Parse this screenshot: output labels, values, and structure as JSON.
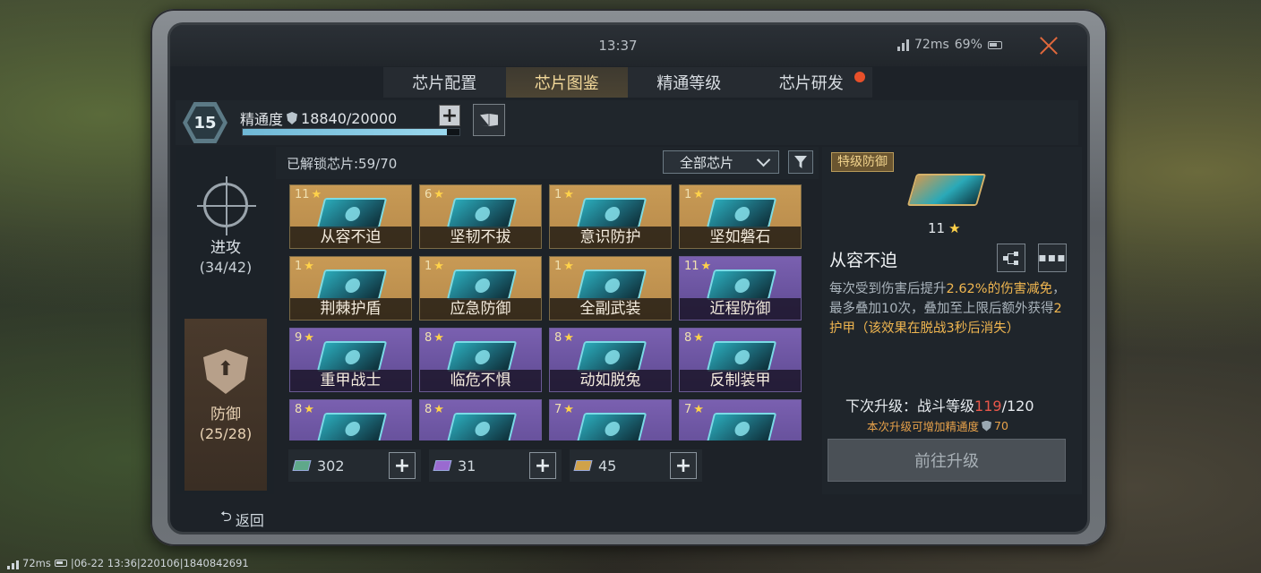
{
  "top": {
    "time": "13:37",
    "ping": "72ms",
    "battery": "69%"
  },
  "tabs": [
    {
      "label": "芯片配置",
      "active": false
    },
    {
      "label": "芯片图鉴",
      "active": true
    },
    {
      "label": "精通等级",
      "active": false
    },
    {
      "label": "芯片研发",
      "active": false,
      "badge": true
    }
  ],
  "mastery": {
    "level": "15",
    "label": "精通度",
    "value": "18840/20000",
    "progress_fraction": 0.942
  },
  "categories": [
    {
      "name": "进攻",
      "count": "(34/42)",
      "active": false
    },
    {
      "name": "防御",
      "count": "(25/28)",
      "active": true
    }
  ],
  "grid": {
    "unlocked_text": "已解锁芯片:59/70",
    "filter_selected": "全部芯片"
  },
  "chips": [
    {
      "stars": "11",
      "name": "从容不迫",
      "rarity": "gold"
    },
    {
      "stars": "6",
      "name": "坚韧不拔",
      "rarity": "gold"
    },
    {
      "stars": "1",
      "name": "意识防护",
      "rarity": "gold"
    },
    {
      "stars": "1",
      "name": "坚如磐石",
      "rarity": "gold"
    },
    {
      "stars": "1",
      "name": "荆棘护盾",
      "rarity": "gold"
    },
    {
      "stars": "1",
      "name": "应急防御",
      "rarity": "gold"
    },
    {
      "stars": "1",
      "name": "全副武装",
      "rarity": "gold"
    },
    {
      "stars": "11",
      "name": "近程防御",
      "rarity": "purple"
    },
    {
      "stars": "9",
      "name": "重甲战士",
      "rarity": "purple"
    },
    {
      "stars": "8",
      "name": "临危不惧",
      "rarity": "purple"
    },
    {
      "stars": "8",
      "name": "动如脱兔",
      "rarity": "purple"
    },
    {
      "stars": "8",
      "name": "反制装甲",
      "rarity": "purple"
    },
    {
      "stars": "8",
      "name": "",
      "rarity": "purple"
    },
    {
      "stars": "8",
      "name": "",
      "rarity": "purple"
    },
    {
      "stars": "7",
      "name": "",
      "rarity": "purple"
    },
    {
      "stars": "7",
      "name": "",
      "rarity": "purple"
    }
  ],
  "resources": [
    {
      "value": "302",
      "color": "#5fa88a"
    },
    {
      "value": "31",
      "color": "#9a6ad0"
    },
    {
      "value": "45",
      "color": "#d0a24a"
    }
  ],
  "detail": {
    "rarity_tag": "特级防御",
    "stars": "11",
    "name": "从容不迫",
    "desc_1": "每次受到伤害后提升",
    "desc_hl1": "2.62%的伤害减免",
    "desc_2": "，最多叠加10次，叠加至上限后额外获得",
    "desc_hl2": "2护甲（该效果在脱战3秒后消失）",
    "next_label": "下次升级：战斗等级",
    "next_current": "119",
    "next_total": "/120",
    "gain_text": "本次升级可增加精通度",
    "gain_value": "70",
    "goto_label": "前往升级"
  },
  "bottom": {
    "back_label": "返回",
    "status_ping": "72ms",
    "status_info": "|06-22 13:36|220106|1840842691"
  }
}
